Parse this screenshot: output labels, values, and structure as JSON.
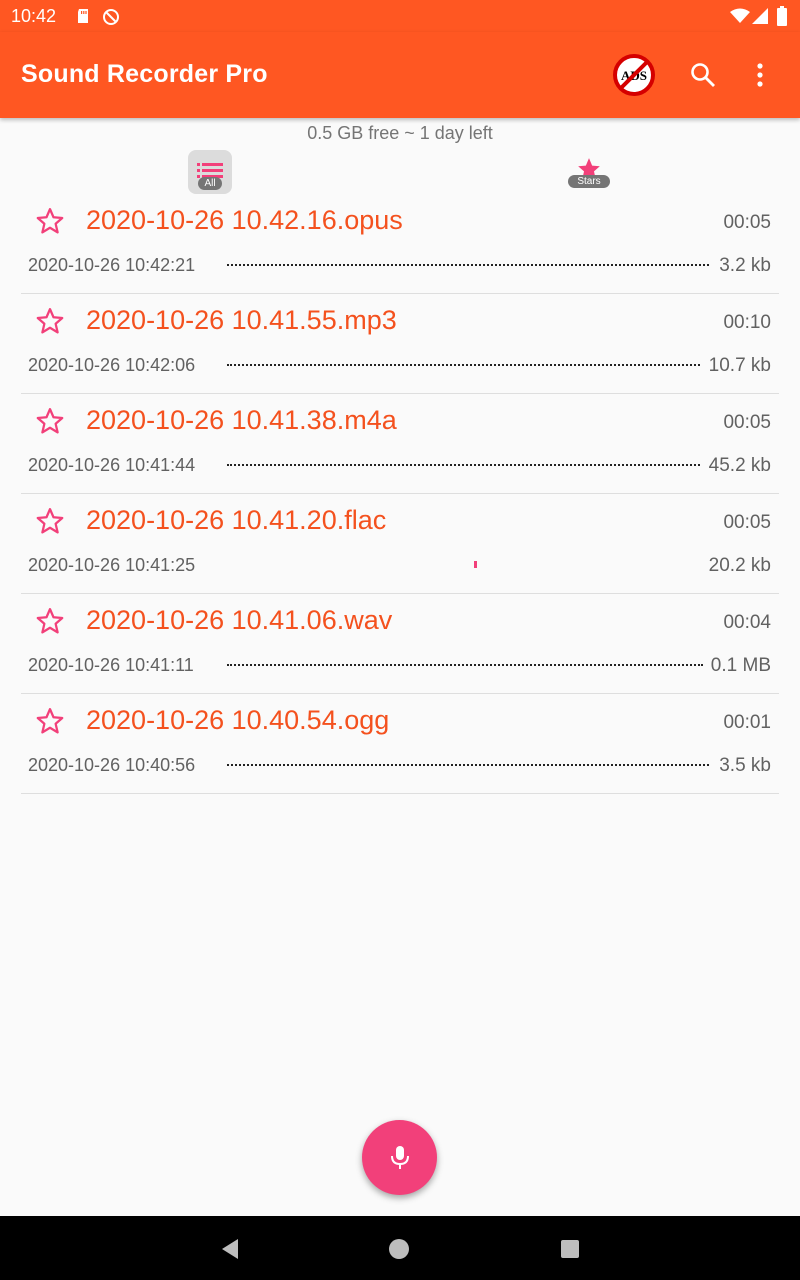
{
  "status_bar": {
    "time": "10:42",
    "icons": [
      "sd-card-icon",
      "no-sync-icon",
      "wifi-icon",
      "signal-icon",
      "battery-icon"
    ]
  },
  "app_bar": {
    "title": "Sound Recorder Pro",
    "badge_text": "ADS",
    "actions": [
      "no-ads-icon",
      "search-icon",
      "more-vert-icon"
    ]
  },
  "storage_info": "0.5 GB free ~ 1 day left",
  "filters": {
    "all_label": "All",
    "stars_label": "Stars"
  },
  "recordings": [
    {
      "name": "2020-10-26 10.42.16.opus",
      "duration": "00:05",
      "date": "2020-10-26 10:42:21",
      "size": "3.2 kb"
    },
    {
      "name": "2020-10-26 10.41.55.mp3",
      "duration": "00:10",
      "date": "2020-10-26 10:42:06",
      "size": "10.7 kb"
    },
    {
      "name": "2020-10-26 10.41.38.m4a",
      "duration": "00:05",
      "date": "2020-10-26 10:41:44",
      "size": "45.2 kb"
    },
    {
      "name": "2020-10-26 10.41.20.flac",
      "duration": "00:05",
      "date": "2020-10-26 10:41:25",
      "size": "20.2 kb"
    },
    {
      "name": "2020-10-26 10.41.06.wav",
      "duration": "00:04",
      "date": "2020-10-26 10:41:11",
      "size": "0.1 MB"
    },
    {
      "name": "2020-10-26 10.40.54.ogg",
      "duration": "00:01",
      "date": "2020-10-26 10:40:56",
      "size": "3.5 kb"
    }
  ],
  "colors": {
    "primary": "#ff5722",
    "accent": "#f2407a",
    "file_name": "#f4511e"
  },
  "fab_icon": "microphone-icon",
  "nav_icons": [
    "back-icon",
    "home-icon",
    "recents-icon"
  ]
}
